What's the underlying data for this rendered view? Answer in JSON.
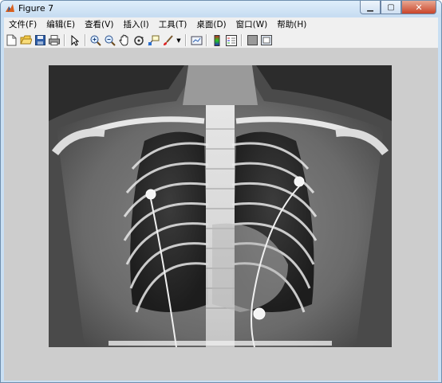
{
  "window": {
    "title": "Figure 7"
  },
  "menu": {
    "items": [
      "文件(F)",
      "编辑(E)",
      "查看(V)",
      "插入(I)",
      "工具(T)",
      "桌面(D)",
      "窗口(W)",
      "帮助(H)"
    ]
  },
  "toolbar": {
    "icons": [
      "new-figure-icon",
      "open-file-icon",
      "save-icon",
      "print-icon",
      "pointer-icon",
      "zoom-in-icon",
      "zoom-out-icon",
      "pan-icon",
      "rotate-3d-icon",
      "data-cursor-icon",
      "brush-icon",
      "brush-dropdown-icon",
      "link-plot-icon",
      "colorbar-icon",
      "legend-icon",
      "hide-plot-tools-icon",
      "show-plot-tools-icon"
    ]
  },
  "figure": {
    "content": "chest x-ray image"
  },
  "colors": {
    "titlebar": "#c6dcf1",
    "menubar": "#f0f0f0",
    "client": "#cdcdcd",
    "close": "#c9452a"
  }
}
